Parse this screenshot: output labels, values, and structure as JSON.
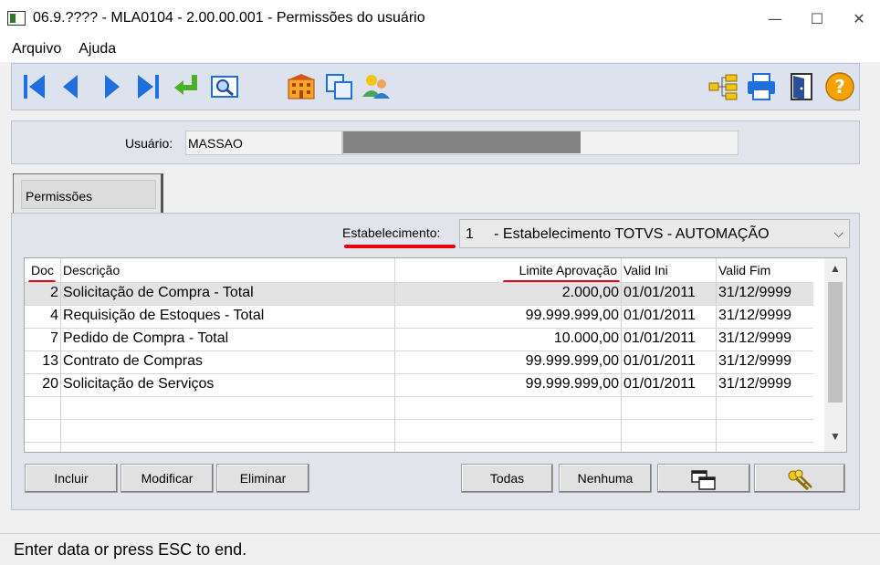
{
  "window": {
    "title": "06.9.???? - MLA0104 - 2.00.00.001 - Permissões do usuário",
    "minimize": "—",
    "maximize": "☐",
    "close": "✕"
  },
  "menu": [
    "Arquivo",
    "Ajuda"
  ],
  "toolbar": {
    "left_icons": [
      "first-record-icon",
      "previous-record-icon",
      "next-record-icon",
      "last-record-icon",
      "return-icon",
      "search-zoom-icon",
      "building-icon",
      "copy-icon",
      "users-icon"
    ],
    "right_icons": [
      "hierarchy-icon",
      "printer-icon",
      "exit-door-icon",
      "help-icon"
    ]
  },
  "user": {
    "label": "Usuário:",
    "code": "MASSAO"
  },
  "tabs": [
    {
      "label": "Permissões"
    }
  ],
  "establishment": {
    "label": "Estabelecimento:",
    "value": "1     - Estabelecimento TOTVS - AUTOMAÇÃO"
  },
  "table": {
    "columns": [
      "Doc",
      "Descrição",
      "Limite Aprovação",
      "Valid Ini",
      "Valid Fim"
    ],
    "rows": [
      {
        "doc": "2",
        "desc": "Solicitação de Compra - Total",
        "limit": "2.000,00",
        "ini": "01/01/2011",
        "fim": "31/12/9999"
      },
      {
        "doc": "4",
        "desc": "Requisição de Estoques - Total",
        "limit": "99.999.999,00",
        "ini": "01/01/2011",
        "fim": "31/12/9999"
      },
      {
        "doc": "7",
        "desc": "Pedido de Compra - Total",
        "limit": "10.000,00",
        "ini": "01/01/2011",
        "fim": "31/12/9999"
      },
      {
        "doc": "13",
        "desc": "Contrato de Compras",
        "limit": "99.999.999,00",
        "ini": "01/01/2011",
        "fim": "31/12/9999"
      },
      {
        "doc": "20",
        "desc": "Solicitação de Serviços",
        "limit": "99.999.999,00",
        "ini": "01/01/2011",
        "fim": "31/12/9999"
      }
    ]
  },
  "buttons": {
    "incluir": "Incluir",
    "modificar": "Modificar",
    "eliminar": "Eliminar",
    "todas": "Todas",
    "nenhuma": "Nenhuma"
  },
  "colors": {
    "accent_red": "#e8000d",
    "toolbar_blue": "#1f6fe0",
    "panel_bg": "#e1e4ea"
  },
  "status": "Enter data or press ESC to end."
}
